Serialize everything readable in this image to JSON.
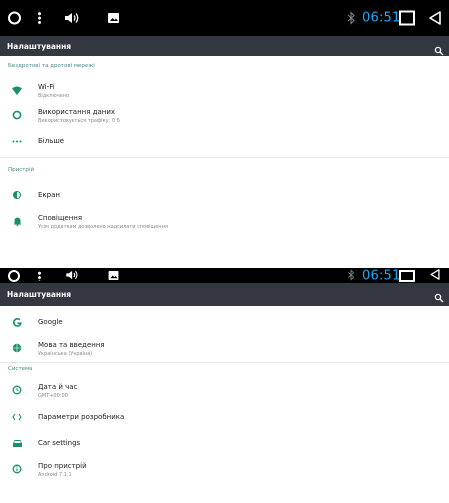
{
  "status_bar": {
    "time": "06:51",
    "icons": [
      "circle-icon",
      "more-vertical-icon",
      "volume-icon",
      "image-icon",
      "bluetooth-icon",
      "square-icon",
      "back-icon"
    ],
    "clock_color": "#19a9ff"
  },
  "screen1": {
    "toolbar_title": "Налаштування",
    "section_wireless": "Бездротові та дротові мережі",
    "items": [
      {
        "title": "Wi-Fi",
        "subtitle": "Відключено",
        "icon": "wifi-icon"
      },
      {
        "title": "Використання даних",
        "subtitle": "Використовується трафіку: 0 Б",
        "icon": "data-usage-icon"
      },
      {
        "title": "Більше",
        "subtitle": "",
        "icon": "more-icon"
      }
    ],
    "section_device": "Пристрій",
    "device_items": [
      {
        "title": "Екран",
        "subtitle": "",
        "icon": "brightness-icon"
      },
      {
        "title": "Сповіщення",
        "subtitle": "Усім додаткам дозволено надсилати сповіщення",
        "icon": "notifications-icon"
      }
    ]
  },
  "screen2": {
    "toolbar_title": "Налаштування",
    "items_top": [
      {
        "title": "Google",
        "subtitle": "",
        "icon": "google-icon"
      },
      {
        "title": "Мова та введення",
        "subtitle": "Українська (Україна)",
        "icon": "language-icon"
      }
    ],
    "section_system": "Система",
    "system_items": [
      {
        "title": "Дата й час",
        "subtitle": "GMT+00:00",
        "icon": "clock-icon"
      },
      {
        "title": "Параметри розробника",
        "subtitle": "",
        "icon": "developer-icon"
      },
      {
        "title": "Car settings",
        "subtitle": "",
        "icon": "car-icon"
      },
      {
        "title": "Про пристрій",
        "subtitle": "Android 7.1.1",
        "icon": "info-icon"
      }
    ]
  },
  "colors": {
    "toolbar": "#333740",
    "accent": "#1d8f6f",
    "section_text": "#4a8c88"
  }
}
